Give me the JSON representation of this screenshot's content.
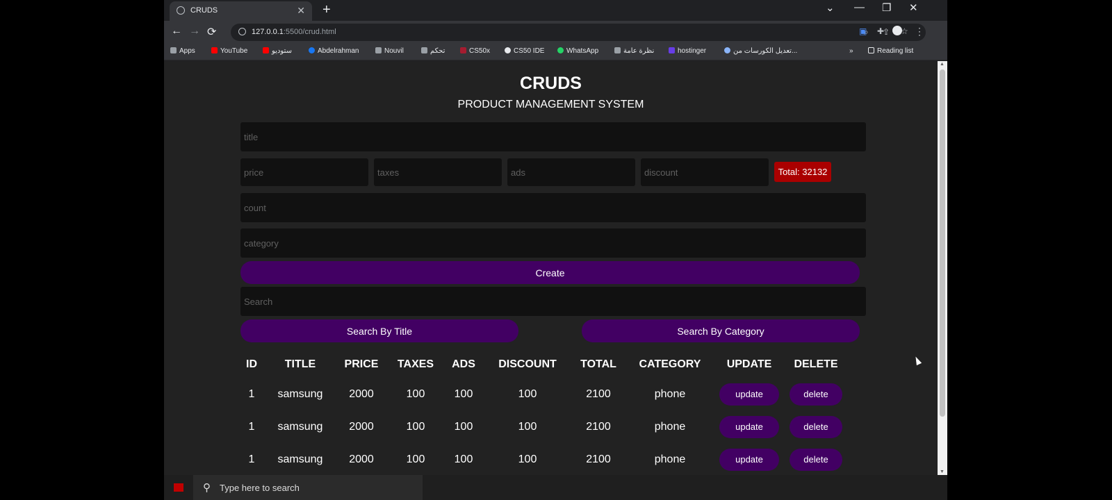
{
  "browser": {
    "tab_title": "CRUDS",
    "tab_close": "✕",
    "new_tab": "+",
    "url_host": "127.0.0.1",
    "url_rest": ":5500/crud.html",
    "window_controls": [
      "⌄",
      "—",
      "❐",
      "✕"
    ],
    "nav": {
      "back": "←",
      "forward": "→",
      "reload": "⟳"
    },
    "toolbar_icons": [
      "zoom-icon",
      "share-icon",
      "star-icon",
      "extension-icon",
      "puzzle-icon",
      "profile-icon",
      "menu-icon"
    ]
  },
  "bookmarks": {
    "items": [
      {
        "label": "Apps",
        "color": "#9aa0a6"
      },
      {
        "label": "YouTube",
        "color": "#ff0000"
      },
      {
        "label": "ستوديو",
        "color": "#ff0000"
      },
      {
        "label": "Abdelrahman",
        "color": "#1877f2"
      },
      {
        "label": "Nouvil",
        "color": "#9aa0a6"
      },
      {
        "label": "تحكم",
        "color": "#9aa0a6"
      },
      {
        "label": "CS50x",
        "color": "#a51c30"
      },
      {
        "label": "CS50 IDE",
        "color": "#e8eaed"
      },
      {
        "label": "WhatsApp",
        "color": "#25d366"
      },
      {
        "label": "نظرة عامة",
        "color": "#9aa0a6"
      },
      {
        "label": "hostinger",
        "color": "#673de6"
      },
      {
        "label": "تعديل الكورسات من...",
        "color": "#8ab4f8"
      }
    ],
    "more": "»",
    "reading_list": "Reading list"
  },
  "app": {
    "title": "CRUDS",
    "subtitle": "PRODUCT MANAGEMENT SYSTEM",
    "placeholders": {
      "title": "title",
      "price": "price",
      "taxes": "taxes",
      "ads": "ads",
      "discount": "discount",
      "count": "count",
      "category": "category",
      "search": "Search"
    },
    "total": "Total: 32132",
    "total_color": "#aa0000",
    "accent": "#420063",
    "create_label": "Create",
    "search_by_title": "Search By Title",
    "search_by_category": "Search By Category"
  },
  "table": {
    "headers": [
      "ID",
      "TITLE",
      "PRICE",
      "TAXES",
      "ADS",
      "DISCOUNT",
      "TOTAL",
      "CATEGORY",
      "UPDATE",
      "DELETE"
    ],
    "rows": [
      {
        "id": "1",
        "title": "samsung",
        "price": "2000",
        "taxes": "100",
        "ads": "100",
        "discount": "100",
        "total": "2100",
        "category": "phone",
        "update": "update",
        "delete": "delete"
      },
      {
        "id": "1",
        "title": "samsung",
        "price": "2000",
        "taxes": "100",
        "ads": "100",
        "discount": "100",
        "total": "2100",
        "category": "phone",
        "update": "update",
        "delete": "delete"
      },
      {
        "id": "1",
        "title": "samsung",
        "price": "2000",
        "taxes": "100",
        "ads": "100",
        "discount": "100",
        "total": "2100",
        "category": "phone",
        "update": "update",
        "delete": "delete"
      }
    ]
  },
  "taskbar": {
    "search_placeholder": "Type here to search"
  }
}
